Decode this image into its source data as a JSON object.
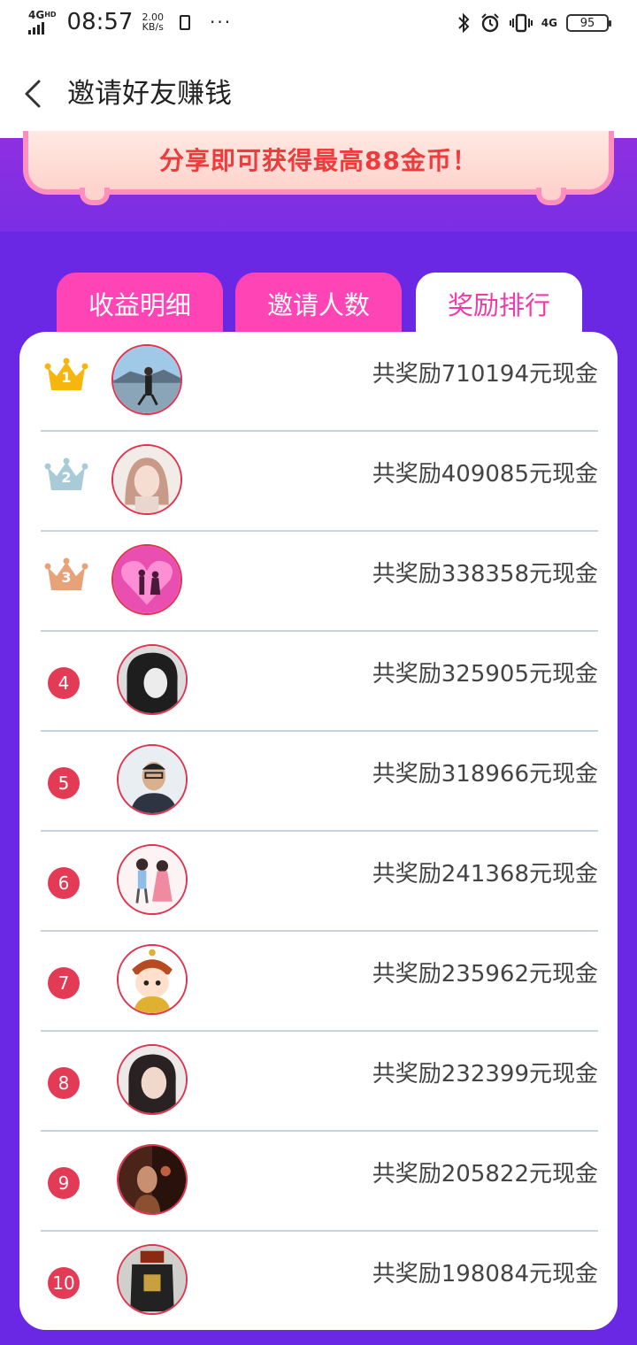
{
  "status_bar": {
    "network": "4G",
    "network_sup": "HD",
    "time": "08:57",
    "speed_value": "2.00",
    "speed_unit": "KB/s",
    "dots": "···",
    "net_right": "4G",
    "battery": "95"
  },
  "header": {
    "title": "邀请好友赚钱"
  },
  "banner": {
    "text": "分享即可获得最高88金币！"
  },
  "tabs": [
    {
      "label": "收益明细"
    },
    {
      "label": "邀请人数"
    },
    {
      "label": "奖励排行"
    }
  ],
  "ranking": [
    {
      "rank": "1",
      "reward": "共奖励710194元现金"
    },
    {
      "rank": "2",
      "reward": "共奖励409085元现金"
    },
    {
      "rank": "3",
      "reward": "共奖励338358元现金"
    },
    {
      "rank": "4",
      "reward": "共奖励325905元现金"
    },
    {
      "rank": "5",
      "reward": "共奖励318966元现金"
    },
    {
      "rank": "6",
      "reward": "共奖励241368元现金"
    },
    {
      "rank": "7",
      "reward": "共奖励235962元现金"
    },
    {
      "rank": "8",
      "reward": "共奖励232399元现金"
    },
    {
      "rank": "9",
      "reward": "共奖励205822元现金"
    },
    {
      "rank": "10",
      "reward": "共奖励198084元现金"
    }
  ],
  "colors": {
    "purple": "#6a28e4",
    "tab_pink": "#ff45b6",
    "active_tab_text": "#ee3ba9",
    "rank_badge": "#e33a55",
    "gold_crown": "#f6b60d",
    "silver_crown": "#a9cbd8",
    "bronze_crown": "#e8a27a",
    "banner_text": "#ee3b3b"
  },
  "icons": {
    "back": "chevron-left-icon",
    "bluetooth": "bluetooth-icon",
    "alarm": "alarm-icon",
    "vibrate": "vibrate-icon",
    "crown": "crown-icon"
  }
}
